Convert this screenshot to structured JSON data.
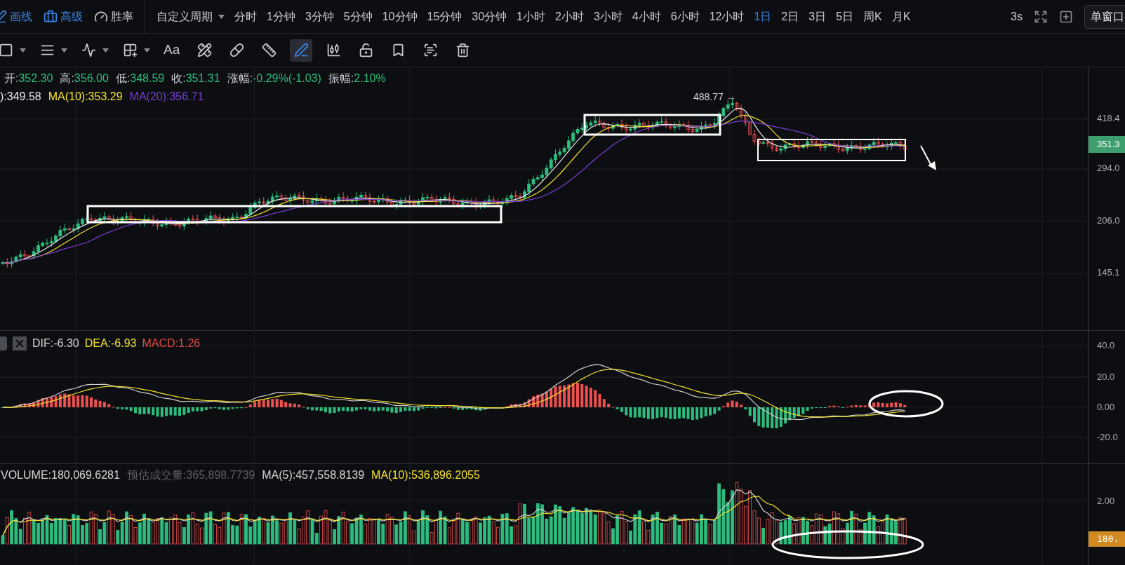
{
  "top_bar": {
    "tools": [
      {
        "kind": "pen",
        "label": "画线",
        "active": true
      },
      {
        "kind": "case",
        "label": "高级",
        "active": true
      },
      {
        "kind": "gauge",
        "label": "胜率",
        "active": false
      }
    ],
    "period_dropdown": "自定义周期",
    "periods": [
      {
        "label": "分时",
        "selected": false
      },
      {
        "label": "1分钟",
        "selected": false
      },
      {
        "label": "3分钟",
        "selected": false
      },
      {
        "label": "5分钟",
        "selected": false
      },
      {
        "label": "10分钟",
        "selected": false
      },
      {
        "label": "15分钟",
        "selected": false
      },
      {
        "label": "30分钟",
        "selected": false
      },
      {
        "label": "1小时",
        "selected": false
      },
      {
        "label": "2小时",
        "selected": false
      },
      {
        "label": "3小时",
        "selected": false
      },
      {
        "label": "4小时",
        "selected": false
      },
      {
        "label": "6小时",
        "selected": false
      },
      {
        "label": "12小时",
        "selected": false
      },
      {
        "label": "1日",
        "selected": true
      },
      {
        "label": "2日",
        "selected": false
      },
      {
        "label": "3日",
        "selected": false
      },
      {
        "label": "5日",
        "selected": false
      },
      {
        "label": "周K",
        "selected": false
      },
      {
        "label": "月K",
        "selected": false
      }
    ],
    "refresh": "3s",
    "window_mode": "单窗口"
  },
  "drawing_tools": [
    {
      "kind": "rectangle",
      "menu": true,
      "selected": false
    },
    {
      "kind": "lines",
      "menu": true,
      "selected": false
    },
    {
      "kind": "wave",
      "menu": true,
      "selected": false
    },
    {
      "kind": "crosshair",
      "menu": true,
      "selected": false
    },
    {
      "kind": "text",
      "label": "Aa",
      "menu": false,
      "selected": false
    },
    {
      "kind": "ruler-pencil",
      "menu": false,
      "selected": false
    },
    {
      "kind": "pill",
      "menu": false,
      "selected": false
    },
    {
      "kind": "ruler",
      "menu": false,
      "selected": false
    },
    {
      "kind": "pen",
      "menu": false,
      "selected": true
    },
    {
      "kind": "candles",
      "menu": false,
      "selected": false
    },
    {
      "kind": "lock",
      "menu": false,
      "selected": false
    },
    {
      "kind": "bookmark",
      "menu": false,
      "selected": false
    },
    {
      "kind": "scan",
      "menu": false,
      "selected": false
    },
    {
      "kind": "trash",
      "menu": false,
      "selected": false
    }
  ],
  "main_chart": {
    "ohlc_legend": [
      {
        "label": "开:",
        "value": "352.30"
      },
      {
        "label": "高:",
        "value": "356.00"
      },
      {
        "label": "低:",
        "value": "348.59"
      },
      {
        "label": "收:",
        "value": "351.31"
      },
      {
        "label": "涨幅:",
        "value": "-0.29%(-1.03)"
      },
      {
        "label": "振幅:",
        "value": "2.10%"
      }
    ],
    "ma_legend": [
      {
        "text": "):349.58",
        "color": "#e8e8e8"
      },
      {
        "text": "MA(10):353.29",
        "color": "#f5e12e"
      },
      {
        "text": "MA(20):356.71",
        "color": "#7b3fd6"
      }
    ],
    "peak_label": "488.77 →",
    "axis_labels": [
      "418.4",
      "294.0",
      "206.0",
      "145.1"
    ],
    "last_price": "351.3"
  },
  "macd_panel": {
    "legend": [
      {
        "text": "DIF:-6.30",
        "color": "#d6d6d6"
      },
      {
        "text": "DEA:-6.93",
        "color": "#f5e12e"
      },
      {
        "text": "MACD:1.26",
        "color": "#e0483f"
      }
    ],
    "axis_labels": [
      "40.0",
      "20.0",
      "0.00",
      "-20.0"
    ]
  },
  "volume_panel": {
    "legend": [
      {
        "text": "VOLUME:180,069.6281",
        "color": "#d6d6d6"
      },
      {
        "text": "预估成交量:365,898.7739",
        "color": "#5d5f66"
      },
      {
        "text": "MA(5):457,558.8139",
        "color": "#d6d6d6"
      },
      {
        "text": "MA(10):536,896.2055",
        "color": "#f5e12e"
      }
    ],
    "axis_labels": [
      "2.00"
    ],
    "last_volume": "180."
  }
}
